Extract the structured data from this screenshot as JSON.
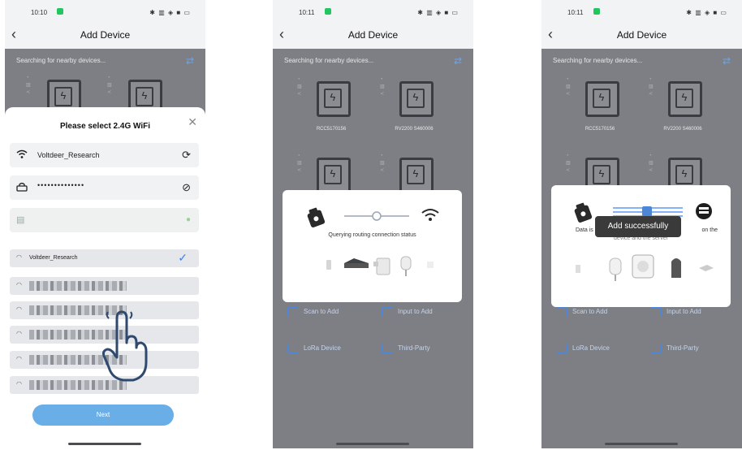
{
  "phones": [
    {
      "status": {
        "time": "10:10",
        "icons": "✱ ▥ ◈ ■ ▭"
      },
      "title": "Add Device",
      "searching_text": "Searching for nearby devices...",
      "sheet": {
        "title": "Please select 2.4G WiFi",
        "wifi_name": "Voltdeer_Research",
        "password_mask": "••••••••••••••",
        "selected_network": "Voltdeer_Research",
        "next_label": "Next"
      }
    },
    {
      "status": {
        "time": "10:11",
        "icons": "✱ ▥ ◈ ■ ▭"
      },
      "title": "Add Device",
      "searching_text": "Searching for nearby devices...",
      "devices": [
        "RCC5170156",
        "RV2200 S460006"
      ],
      "dialog_text": "Querying routing connection status",
      "actions": [
        "Scan to Add",
        "Input to Add",
        "LoRa Device",
        "Third-Party"
      ]
    },
    {
      "status": {
        "time": "10:11",
        "icons": "✱ ▥ ◈ ■ ▭"
      },
      "title": "Add Device",
      "searching_text": "Searching for nearby devices...",
      "devices": [
        "RCC5170156",
        "RV2200 S460006"
      ],
      "dialog_text_left": "Data is",
      "dialog_text_right": "on the",
      "dialog_text_line2": "device and the server",
      "toast": "Add successfully",
      "actions": [
        "Scan to Add",
        "Input to Add",
        "LoRa Device",
        "Third-Party"
      ]
    }
  ]
}
